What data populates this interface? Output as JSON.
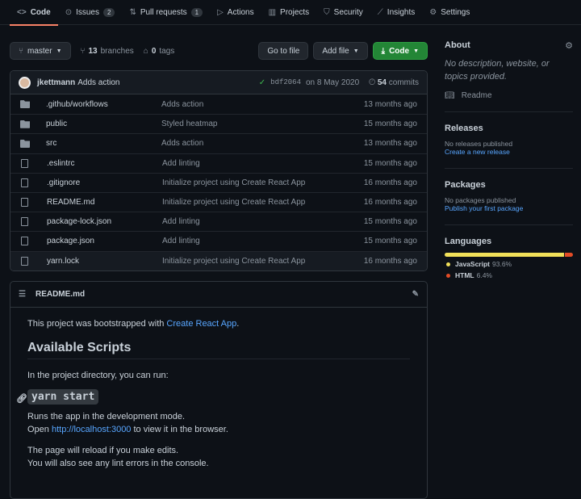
{
  "tabs": [
    {
      "label": "Code",
      "icon": "<>"
    },
    {
      "label": "Issues",
      "icon": "⊙",
      "count": "2"
    },
    {
      "label": "Pull requests",
      "icon": "⇅",
      "count": "1"
    },
    {
      "label": "Actions",
      "icon": "▷"
    },
    {
      "label": "Projects",
      "icon": "▥"
    },
    {
      "label": "Security",
      "icon": "⛉"
    },
    {
      "label": "Insights",
      "icon": "⟋"
    },
    {
      "label": "Settings",
      "icon": "⚙"
    }
  ],
  "toolbar": {
    "branch": "master",
    "branches_count": "13",
    "branches_label": "branches",
    "tags_count": "0",
    "tags_label": "tags",
    "go_to_file": "Go to file",
    "add_file": "Add file",
    "code": "Code"
  },
  "commit": {
    "author": "jkettmann",
    "message": "Adds action",
    "sha": "bdf2064",
    "date": "on 8 May 2020",
    "commits_count": "54",
    "commits_label": "commits"
  },
  "files": [
    {
      "name": ".github/workflows",
      "type": "dir",
      "message": "Adds action",
      "age": "13 months ago"
    },
    {
      "name": "public",
      "type": "dir",
      "message": "Styled heatmap",
      "age": "15 months ago"
    },
    {
      "name": "src",
      "type": "dir",
      "message": "Adds action",
      "age": "13 months ago"
    },
    {
      "name": ".eslintrc",
      "type": "file",
      "message": "Add linting",
      "age": "15 months ago"
    },
    {
      "name": ".gitignore",
      "type": "file",
      "message": "Initialize project using Create React App",
      "age": "16 months ago"
    },
    {
      "name": "README.md",
      "type": "file",
      "message": "Initialize project using Create React App",
      "age": "16 months ago"
    },
    {
      "name": "package-lock.json",
      "type": "file",
      "message": "Add linting",
      "age": "15 months ago"
    },
    {
      "name": "package.json",
      "type": "file",
      "message": "Add linting",
      "age": "15 months ago"
    },
    {
      "name": "yarn.lock",
      "type": "file",
      "message": "Initialize project using Create React App",
      "age": "16 months ago"
    }
  ],
  "readme": {
    "title": "README.md",
    "intro_pre": "This project was bootstrapped with ",
    "intro_link": "Create React App",
    "intro_post": ".",
    "h2": "Available Scripts",
    "p1": "In the project directory, you can run:",
    "h3": "yarn start",
    "p2a": "Runs the app in the development mode.",
    "p2b_pre": "Open ",
    "p2b_link": "http://localhost:3000",
    "p2b_post": " to view it in the browser.",
    "p3a": "The page will reload if you make edits.",
    "p3b": "You will also see any lint errors in the console."
  },
  "about": {
    "title": "About",
    "description": "No description, website, or topics provided.",
    "readme": "Readme"
  },
  "releases": {
    "title": "Releases",
    "text": "No releases published",
    "link": "Create a new release"
  },
  "packages": {
    "title": "Packages",
    "text": "No packages published",
    "link": "Publish your first package"
  },
  "languages": {
    "title": "Languages",
    "items": [
      {
        "name": "JavaScript",
        "percent": "93.6%",
        "value": 93.6,
        "color": "#f1e05a"
      },
      {
        "name": "HTML",
        "percent": "6.4%",
        "value": 6.4,
        "color": "#e34c26"
      }
    ]
  }
}
